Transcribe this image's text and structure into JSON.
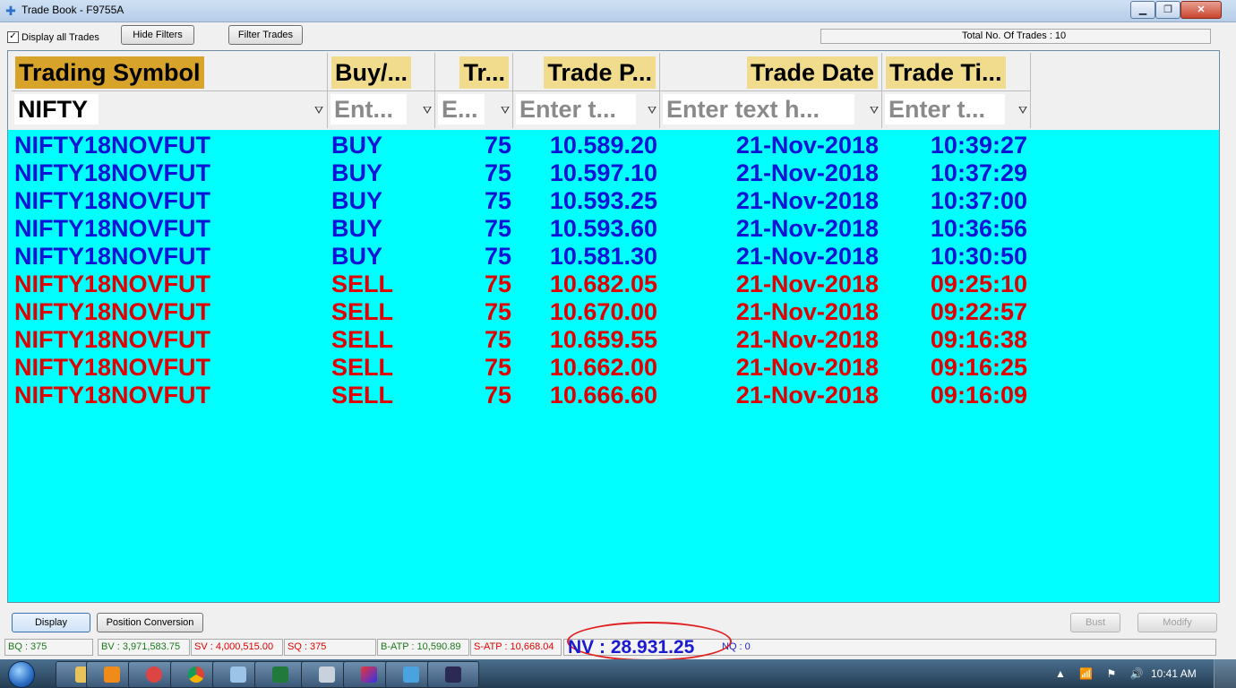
{
  "window": {
    "title": "Trade Book - F9755A",
    "minimize": "▁",
    "maximize": "❐",
    "close": "✕"
  },
  "toolbar": {
    "display_all_label": "Display all Trades",
    "display_all_checked": "✓",
    "hide_filters_label": "Hide Filters",
    "filter_trades_label": "Filter Trades",
    "total_trades_label": "Total No. Of Trades : 10"
  },
  "grid": {
    "headers": [
      "Trading Symbol",
      "Buy/...",
      "Tr...",
      "Trade P...",
      "Trade Date",
      "Trade Ti..."
    ],
    "filters": [
      "NIFTY",
      "Ent...",
      "E...",
      "Enter t...",
      "Enter text h...",
      "Enter t..."
    ],
    "header_highlight_color": "#d8a32a",
    "header_color": "#f1dc8e",
    "background_color": "#00ffff",
    "buy_color": "#0a14d6",
    "sell_color": "#e00000",
    "rows": [
      {
        "symbol": "NIFTY18NOVFUT",
        "side": "BUY",
        "qty": "75",
        "price": "10.589.20",
        "date": "21-Nov-2018",
        "time": "10:39:27"
      },
      {
        "symbol": "NIFTY18NOVFUT",
        "side": "BUY",
        "qty": "75",
        "price": "10.597.10",
        "date": "21-Nov-2018",
        "time": "10:37:29"
      },
      {
        "symbol": "NIFTY18NOVFUT",
        "side": "BUY",
        "qty": "75",
        "price": "10.593.25",
        "date": "21-Nov-2018",
        "time": "10:37:00"
      },
      {
        "symbol": "NIFTY18NOVFUT",
        "side": "BUY",
        "qty": "75",
        "price": "10.593.60",
        "date": "21-Nov-2018",
        "time": "10:36:56"
      },
      {
        "symbol": "NIFTY18NOVFUT",
        "side": "BUY",
        "qty": "75",
        "price": "10.581.30",
        "date": "21-Nov-2018",
        "time": "10:30:50"
      },
      {
        "symbol": "NIFTY18NOVFUT",
        "side": "SELL",
        "qty": "75",
        "price": "10.682.05",
        "date": "21-Nov-2018",
        "time": "09:25:10"
      },
      {
        "symbol": "NIFTY18NOVFUT",
        "side": "SELL",
        "qty": "75",
        "price": "10.670.00",
        "date": "21-Nov-2018",
        "time": "09:22:57"
      },
      {
        "symbol": "NIFTY18NOVFUT",
        "side": "SELL",
        "qty": "75",
        "price": "10.659.55",
        "date": "21-Nov-2018",
        "time": "09:16:38"
      },
      {
        "symbol": "NIFTY18NOVFUT",
        "side": "SELL",
        "qty": "75",
        "price": "10.662.00",
        "date": "21-Nov-2018",
        "time": "09:16:25"
      },
      {
        "symbol": "NIFTY18NOVFUT",
        "side": "SELL",
        "qty": "75",
        "price": "10.666.60",
        "date": "21-Nov-2018",
        "time": "09:16:09"
      }
    ]
  },
  "bottom": {
    "display_label": "Display",
    "position_conversion_label": "Position Conversion",
    "bust_label": "Bust",
    "modify_label": "Modify"
  },
  "status": {
    "bq": "BQ : 375",
    "bv": "BV : 3,971,583.75",
    "sv": "SV : 4,000,515.00",
    "sq": "SQ : 375",
    "batp": "B-ATP : 10,590.89",
    "satp": "S-ATP : 10,668.04",
    "nv": "NV : 28.931.25",
    "nq": "NQ : 0",
    "green_color": "#1a7a1a",
    "red_color": "#e00000",
    "blue_color": "#1a1ad0"
  },
  "taskbar": {
    "clock": "10:41 AM",
    "tray": "▲ 📶 ⚑ 🔊"
  }
}
